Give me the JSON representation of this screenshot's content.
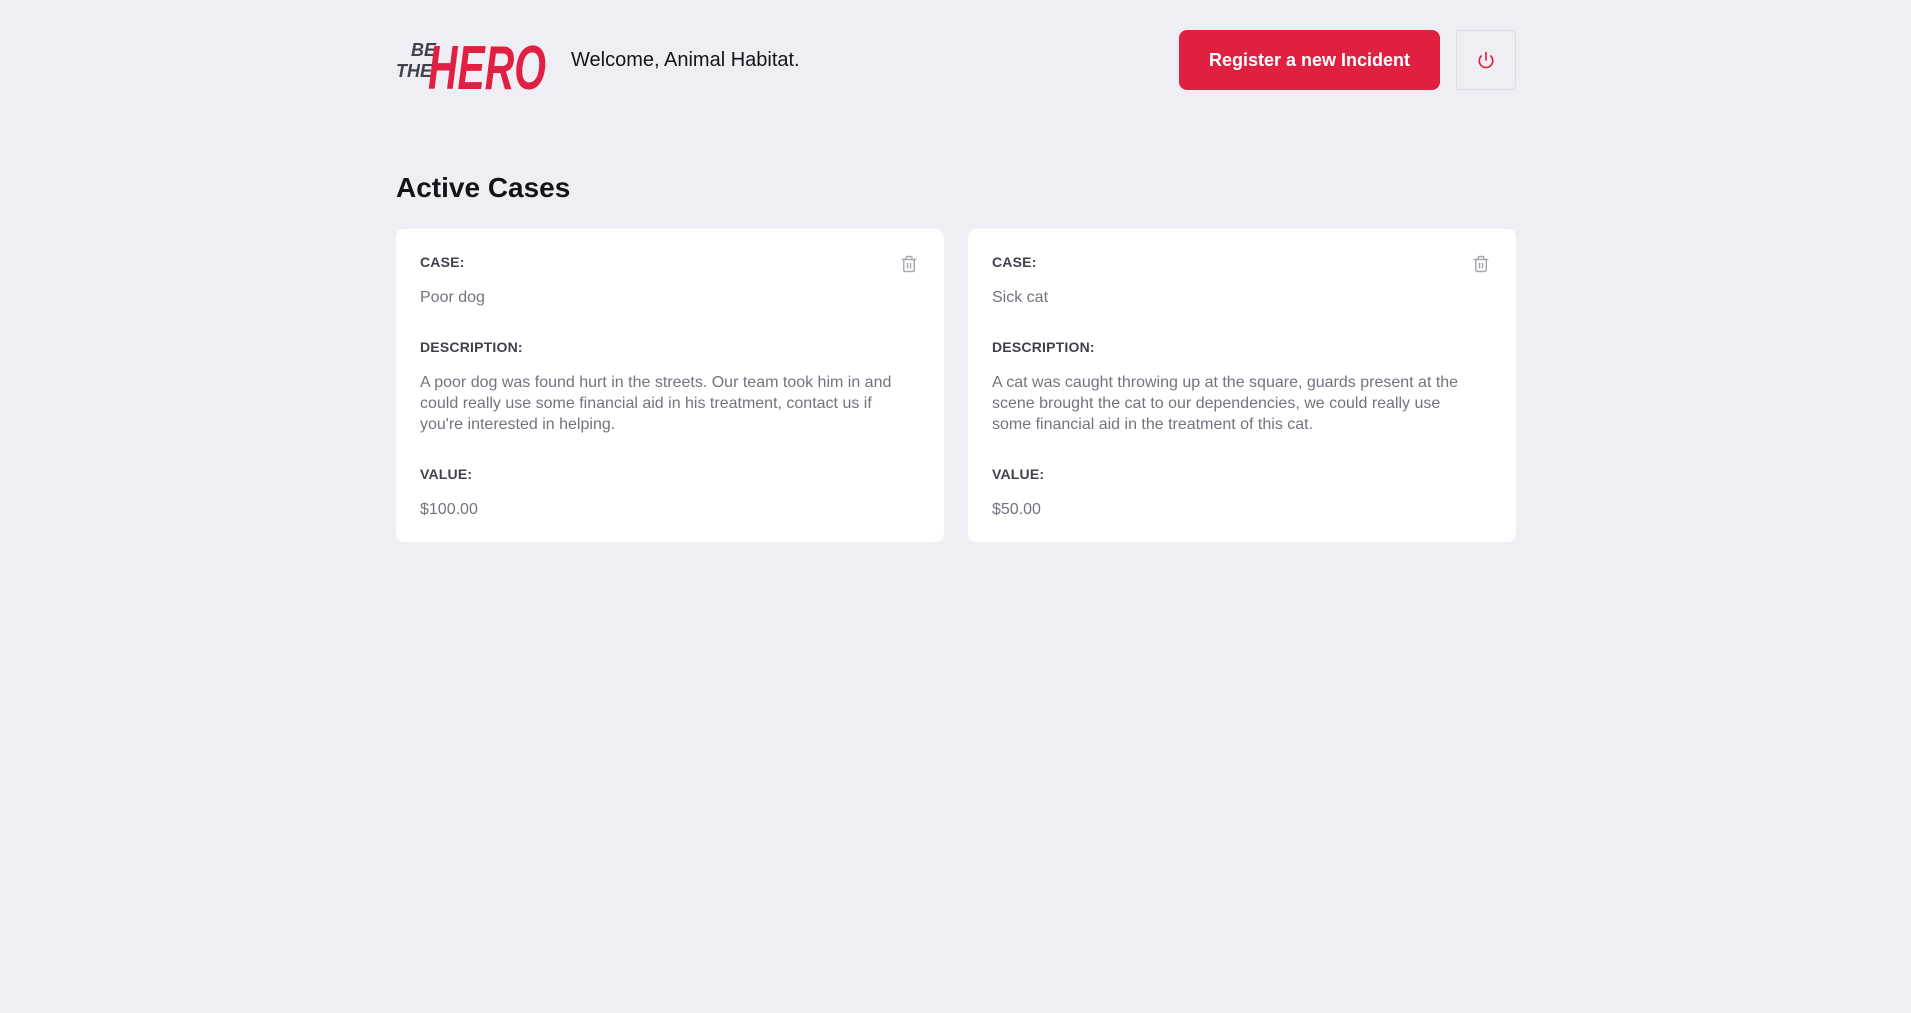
{
  "header": {
    "logo_line1": "BE",
    "logo_line2": "THE",
    "logo_main": "HERO",
    "welcome": "Welcome, Animal Habitat.",
    "register_label": "Register a new Incident",
    "logout_icon": "power-icon"
  },
  "main": {
    "title": "Active Cases",
    "labels": {
      "case": "CASE:",
      "description": "DESCRIPTION:",
      "value": "VALUE:"
    },
    "cases": [
      {
        "title": "Poor dog",
        "description": "A poor dog was found hurt in the streets. Our team took him in and could really use some financial aid in his treatment, contact us if you're interested in helping.",
        "value": "$100.00"
      },
      {
        "title": "Sick cat",
        "description": "A cat was caught throwing up at the square, guards present at the scene brought the cat to our dependencies, we could really use some financial aid in the treatment of this cat.",
        "value": "$50.00"
      }
    ]
  },
  "colors": {
    "brand": "#E02041",
    "background": "#F0EEF5",
    "card": "#FFFFFF",
    "text_dark": "#13131A",
    "label": "#41414D",
    "muted": "#737380",
    "icon_gray": "#A8A8B3"
  }
}
